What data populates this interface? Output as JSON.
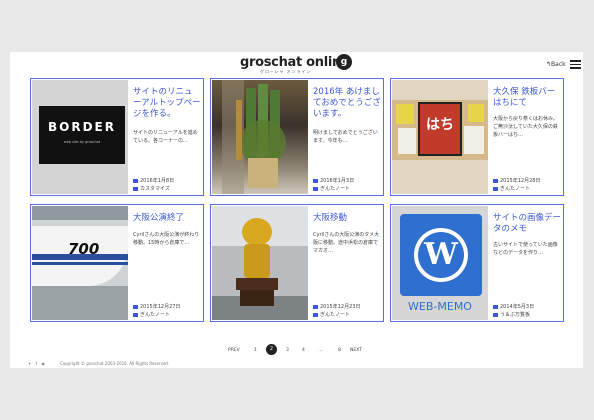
{
  "header": {
    "logo": "groschat online",
    "logo_sub": "グロ−シャ オンライン",
    "logo_mark": "g",
    "back": "Back"
  },
  "cards": [
    {
      "title": "サイトのリニューアルトップページを作る。",
      "excerpt": "サイトのリニューアルを進めている。各コーナーの…",
      "date": "2016年1月8日",
      "category": "カスタマイズ",
      "thumb_text": "BORDER",
      "thumb_sub": "web site by groschat"
    },
    {
      "title": "2016年 あけましておめでとうございます。",
      "excerpt": "明けましておめでとうございます。今年も…",
      "date": "2016年1月3日",
      "category": "ぎんたノート"
    },
    {
      "title": "大久保 鉄板バー はちにて",
      "excerpt": "大阪から戻り祭くはお休み。ご無沙汰していた大久保の鉄板バーはち…",
      "date": "2015年12月28日",
      "category": "ぎんたノート",
      "thumb_text": "はち"
    },
    {
      "title": "大阪公演終了",
      "excerpt": "Cyrilさんの大阪公演が終わり移動。15時から倉庫で…",
      "date": "2015年12月27日",
      "category": "ぎんたノート",
      "thumb_text": "700"
    },
    {
      "title": "大阪移動",
      "excerpt": "Cyrilさんの大阪公演のタメ大阪に移動。途中浜松の倉庫でマカオ…",
      "date": "2015年12月23日",
      "category": "ぎんたノート"
    },
    {
      "title": "サイトの画像データのメモ",
      "excerpt": "古いサイトで使っていた画像などのデータを作り…",
      "date": "2014年5月3日",
      "category": "う＆ぶ万覧板",
      "thumb_text": "WEB-MEMO"
    }
  ],
  "pager": {
    "prev": "PREV",
    "p1": "1",
    "p2": "2",
    "p3": "3",
    "p4": "4",
    "dots": "…",
    "p8": "8",
    "next": "NEXT"
  },
  "footer": {
    "copyright": "Copyright © groschat 2003-2016. All Rights Reserved."
  },
  "colors": {
    "accent": "#3b58d8",
    "border": "#5a6fe6",
    "wp_blue": "#2f6fd0"
  }
}
